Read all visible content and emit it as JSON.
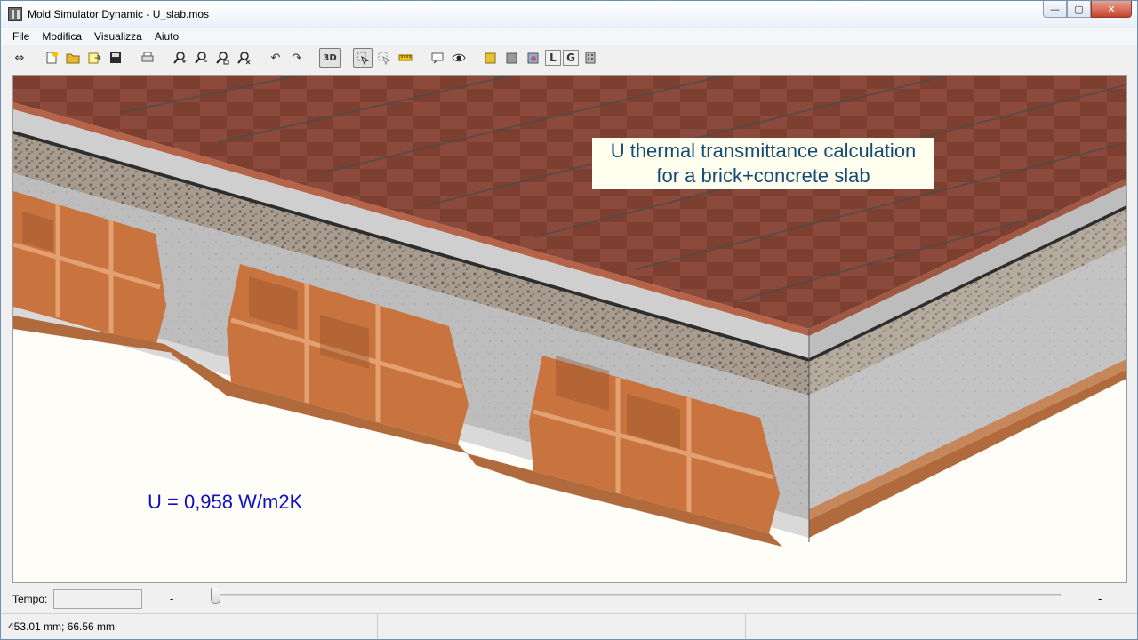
{
  "window": {
    "title": "Mold Simulator Dynamic - U_slab.mos",
    "controls": {
      "minimize": "—",
      "maximize": "▢",
      "close": "✕"
    }
  },
  "menu": {
    "items": [
      "File",
      "Modifica",
      "Visualizza",
      "Aiuto"
    ]
  },
  "toolbar": {
    "buttons": [
      {
        "name": "arrows-icon",
        "glyph": "⇔"
      },
      {
        "name": "new-file-icon",
        "glyph": ""
      },
      {
        "name": "open-folder-icon",
        "glyph": ""
      },
      {
        "name": "export-icon",
        "glyph": ""
      },
      {
        "name": "save-icon",
        "glyph": ""
      },
      {
        "name": "print-icon",
        "glyph": ""
      },
      {
        "name": "zoom-in-icon",
        "glyph": ""
      },
      {
        "name": "zoom-out-icon",
        "glyph": ""
      },
      {
        "name": "zoom-fit-icon",
        "glyph": ""
      },
      {
        "name": "zoom-reset-icon",
        "glyph": ""
      },
      {
        "name": "undo-icon",
        "glyph": "↶"
      },
      {
        "name": "redo-icon",
        "glyph": "↷"
      }
    ],
    "view_3d_label": "3D",
    "layer_L_label": "L",
    "layer_G_label": "G"
  },
  "canvas": {
    "annotation_line1": "U thermal transmittance calculation",
    "annotation_line2": "for a brick+concrete slab",
    "u_value_text": "U = 0,958 W/m2K",
    "colors": {
      "tile": "#8a4a3a",
      "tile_dark": "#6e3828",
      "screed": "#c9c9c9",
      "gravel": "#8e8276",
      "concrete": "#b8b8b8",
      "brick": "#c9743f",
      "plaster": "#e2e2e2"
    }
  },
  "timebar": {
    "tempo_label": "Tempo:",
    "tempo_value": "",
    "start_dash": "-",
    "end_dash": "-",
    "slider_position": 0
  },
  "status": {
    "coordinates": "453.01 mm; 66.56 mm",
    "cell2": "",
    "cell3": ""
  }
}
